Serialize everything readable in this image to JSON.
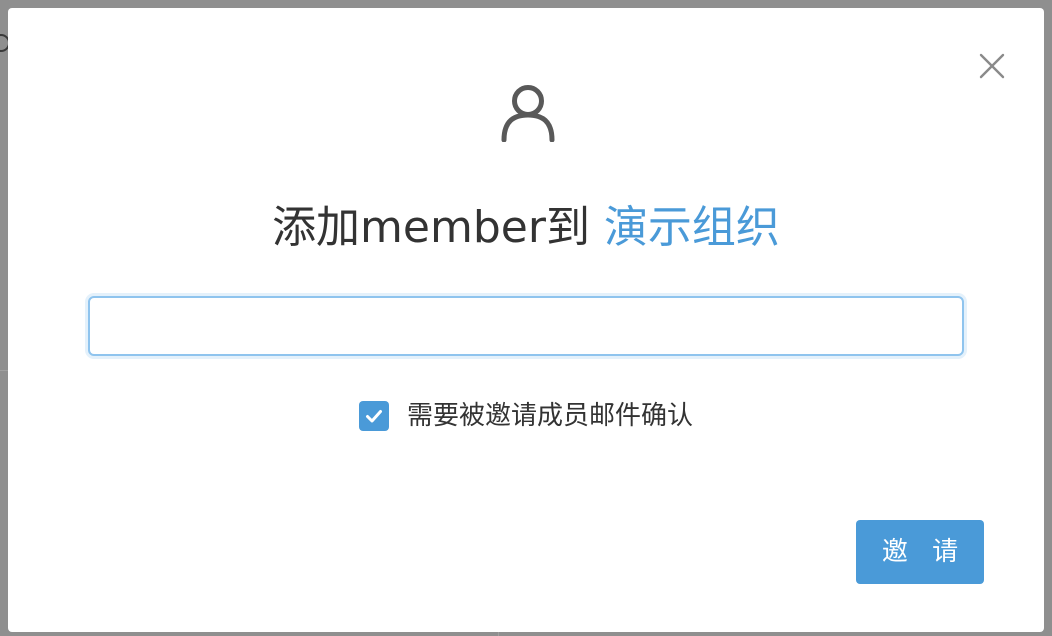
{
  "dialog": {
    "title_prefix": "添加member到 ",
    "org_name": "演示组织",
    "input": {
      "value": "",
      "placeholder": ""
    },
    "confirm_checkbox": {
      "checked": true,
      "label": "需要被邀请成员邮件确认"
    },
    "invite_button_label": "邀 请"
  },
  "colors": {
    "accent": "#4a9ad8",
    "title_text": "#333333",
    "backdrop": "#8f8f8f"
  },
  "icons": {
    "header": "user-icon",
    "close": "close-icon",
    "check": "check-icon"
  }
}
